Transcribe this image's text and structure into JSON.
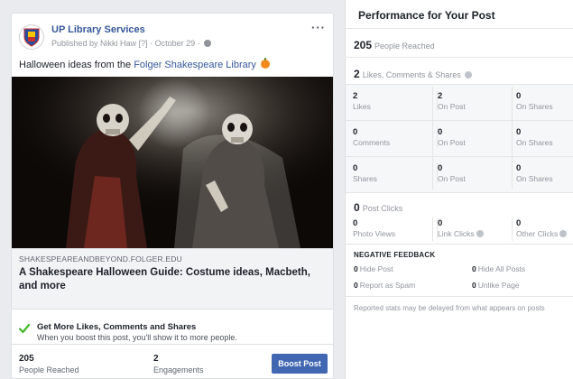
{
  "post": {
    "page_name": "UP Library Services",
    "published_by": "Published by Nikki Haw",
    "help_mark": "[?]",
    "date": "October 29",
    "more_icon": "more-dots-icon",
    "text_prefix": "Halloween ideas from the ",
    "text_link": "Folger Shakespeare Library",
    "link_domain": "SHAKESPEAREANDBEYOND.FOLGER.EDU",
    "link_title": "A Shakespeare Halloween Guide: Costume ideas, Macbeth, and more",
    "boost_title": "Get More Likes, Comments and Shares",
    "boost_subtitle": "When you boost this post, you'll show it to more people.",
    "stats": [
      {
        "value": "205",
        "label": "People Reached"
      },
      {
        "value": "2",
        "label": "Engagements"
      }
    ],
    "boost_button": "Boost Post",
    "accent_color": "#4267b2",
    "link_color": "#365899"
  },
  "performance": {
    "title": "Performance for Your Post",
    "reached": {
      "value": "205",
      "label": "People Reached"
    },
    "engagement": {
      "value": "2",
      "label": "Likes, Comments & Shares"
    },
    "rows": [
      [
        {
          "value": "2",
          "label": "Likes"
        },
        {
          "value": "2",
          "label": "On Post"
        },
        {
          "value": "0",
          "label": "On Shares"
        }
      ],
      [
        {
          "value": "0",
          "label": "Comments"
        },
        {
          "value": "0",
          "label": "On Post"
        },
        {
          "value": "0",
          "label": "On Shares"
        }
      ],
      [
        {
          "value": "0",
          "label": "Shares"
        },
        {
          "value": "0",
          "label": "On Post"
        },
        {
          "value": "0",
          "label": "On Shares"
        }
      ]
    ],
    "post_clicks": {
      "value": "0",
      "label": "Post Clicks"
    },
    "clicks": [
      {
        "value": "0",
        "label": "Photo Views"
      },
      {
        "value": "0",
        "label": "Link Clicks"
      },
      {
        "value": "0",
        "label": "Other Clicks"
      }
    ],
    "negative_title": "NEGATIVE FEEDBACK",
    "negative": [
      {
        "value": "0",
        "label": "Hide Post"
      },
      {
        "value": "0",
        "label": "Hide All Posts"
      },
      {
        "value": "0",
        "label": "Report as Spam"
      },
      {
        "value": "0",
        "label": "Unlike Page"
      }
    ],
    "footnote": "Reported stats may be delayed from what appears on posts"
  }
}
